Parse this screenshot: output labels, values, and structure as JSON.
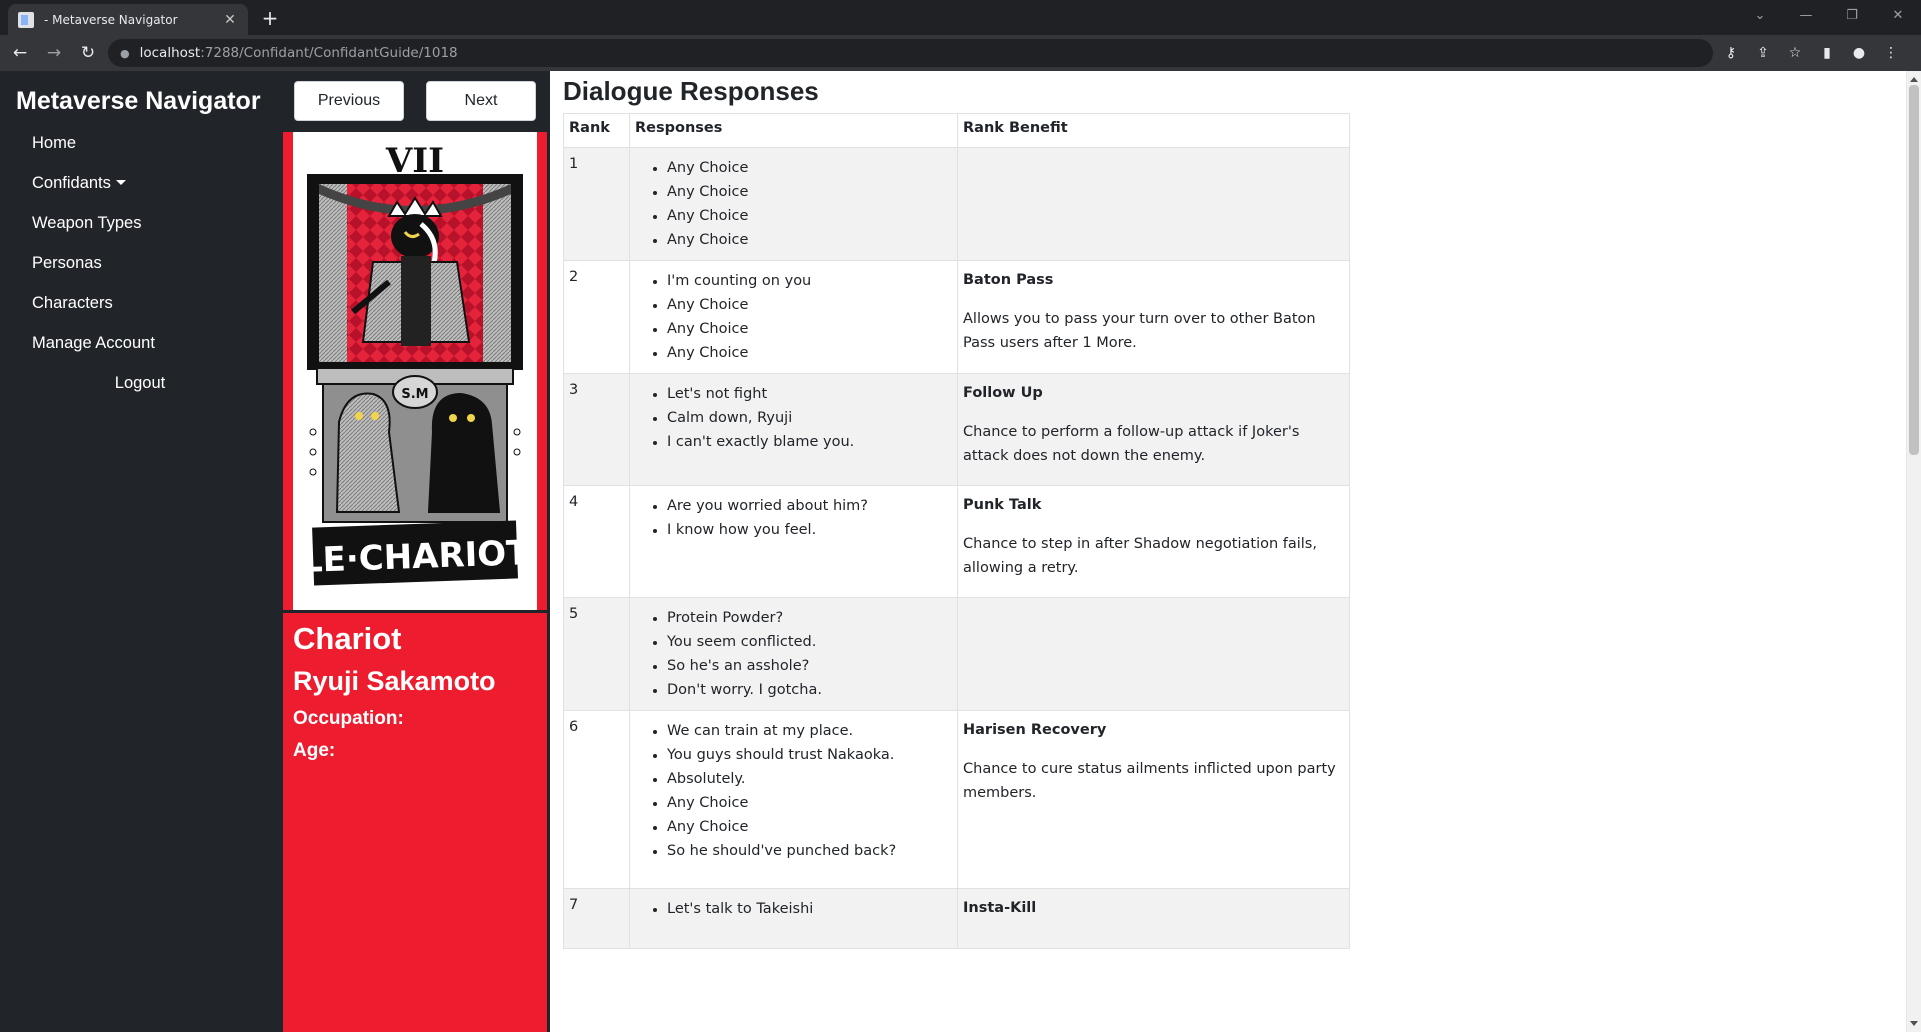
{
  "browser": {
    "tab_title": "- Metaverse Navigator",
    "url_host": "localhost",
    "url_rest": ":7288/Confidant/ConfidantGuide/1018"
  },
  "sidebar": {
    "brand": "Metaverse Navigator",
    "items": [
      {
        "label": "Home"
      },
      {
        "label": "Confidants"
      },
      {
        "label": "Weapon Types"
      },
      {
        "label": "Personas"
      },
      {
        "label": "Characters"
      },
      {
        "label": "Manage Account"
      },
      {
        "label": "Logout"
      }
    ]
  },
  "card": {
    "prev_label": "Previous",
    "next_label": "Next",
    "numeral": "VII",
    "card_caption": "LE·CHARIOT",
    "seal_text": "S.M",
    "arcana": "Chariot",
    "name": "Ryuji Sakamoto",
    "occupation_label": "Occupation:",
    "age_label": "Age:"
  },
  "main": {
    "title": "Dialogue Responses",
    "headers": [
      "Rank",
      "Responses",
      "Rank Benefit"
    ],
    "rows": [
      {
        "rank": "1",
        "responses": [
          "Any Choice",
          "Any Choice",
          "Any Choice",
          "Any Choice"
        ],
        "benefit": "",
        "description": ""
      },
      {
        "rank": "2",
        "responses": [
          "I'm counting on you",
          "Any Choice",
          "Any Choice",
          "Any Choice"
        ],
        "benefit": "Baton Pass",
        "description": "Allows you to pass your turn over to other Baton Pass users after 1 More."
      },
      {
        "rank": "3",
        "responses": [
          "Let's not fight",
          "Calm down, Ryuji",
          "I can't exactly blame you."
        ],
        "benefit": "Follow Up",
        "description": "Chance to perform a follow-up attack if Joker's attack does not down the enemy."
      },
      {
        "rank": "4",
        "responses": [
          "Are you worried about him?",
          "I know how you feel."
        ],
        "benefit": "Punk Talk",
        "description": "Chance to step in after Shadow negotiation fails, allowing a retry."
      },
      {
        "rank": "5",
        "responses": [
          "Protein Powder?",
          "You seem conflicted.",
          "So he's an asshole?",
          "Don't worry. I gotcha."
        ],
        "benefit": "",
        "description": ""
      },
      {
        "rank": "6",
        "responses": [
          "We can train at my place.",
          "You guys should trust Nakaoka.",
          "Absolutely.",
          "Any Choice",
          "Any Choice",
          "So he should've punched back?"
        ],
        "benefit": "Harisen Recovery",
        "description": "Chance to cure status ailments inflicted upon party members."
      },
      {
        "rank": "7",
        "responses": [
          "Let's talk to Takeishi"
        ],
        "benefit": "Insta-Kill",
        "description": ""
      }
    ]
  }
}
